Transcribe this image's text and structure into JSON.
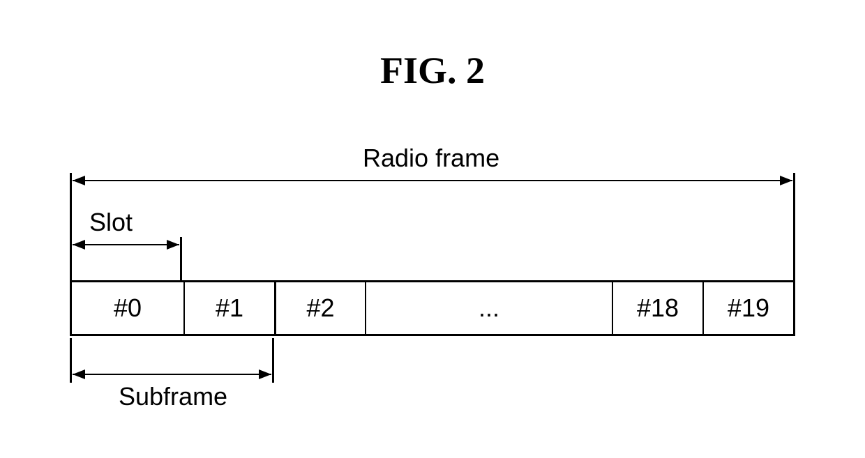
{
  "figure": {
    "title": "FIG. 2"
  },
  "labels": {
    "radio_frame": "Radio frame",
    "slot": "Slot",
    "subframe": "Subframe"
  },
  "slots": {
    "s0": "#0",
    "s1": "#1",
    "s2": "#2",
    "ellipsis": "...",
    "s18": "#18",
    "s19": "#19"
  }
}
